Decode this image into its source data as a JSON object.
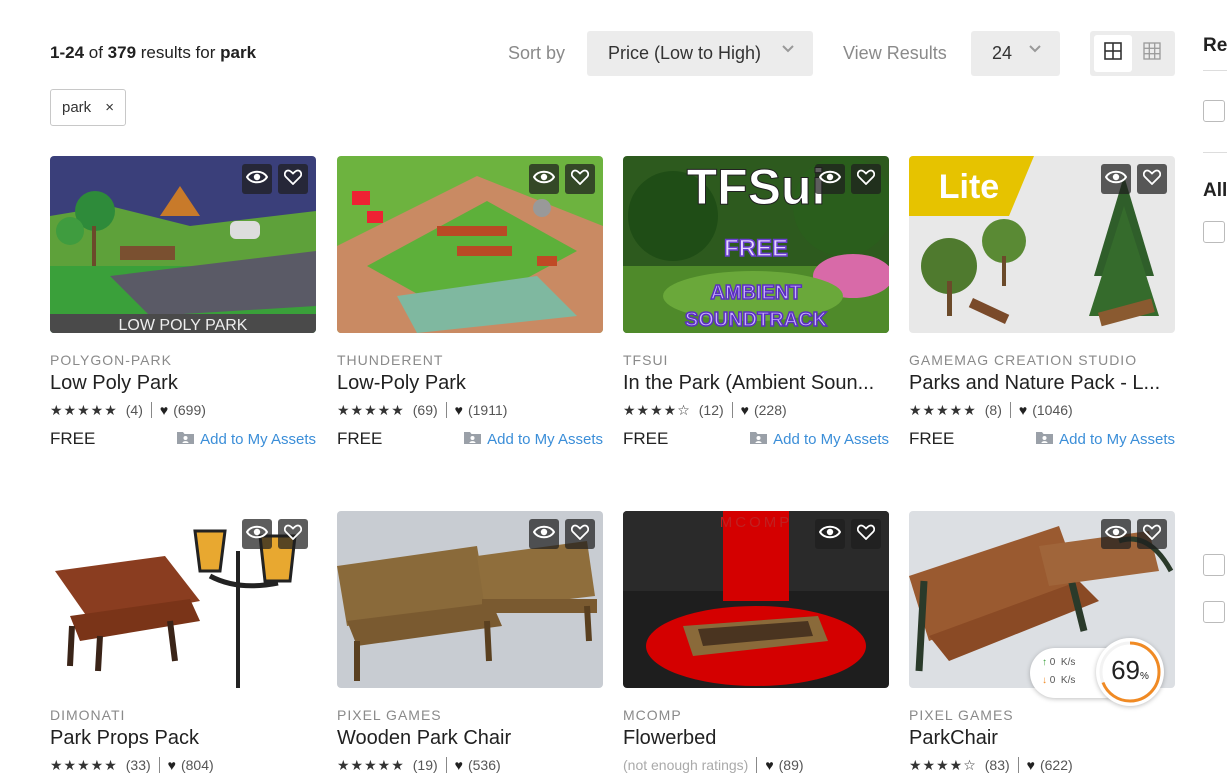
{
  "header": {
    "range": "1-24",
    "of_text": " of ",
    "total": "379",
    "results_for_text": " results for ",
    "query": "park",
    "sort_label": "Sort by",
    "sort_value": "Price (Low to High)",
    "view_label": "View Results",
    "view_value": "24"
  },
  "filter_chip": {
    "label": "park",
    "remove": "×"
  },
  "sidebar": {
    "heading_1": "Re",
    "heading_2": "All"
  },
  "add_label": "Add to My Assets",
  "cards": [
    {
      "publisher": "POLYGON-PARK",
      "title": "Low Poly Park",
      "stars": "★★★★★",
      "ratings": "(4)",
      "likes": "(699)",
      "price": "FREE",
      "overlay_text": "LOW POLY PARK"
    },
    {
      "publisher": "THUNDERENT",
      "title": "Low-Poly Park",
      "stars": "★★★★★",
      "ratings": "(69)",
      "likes": "(1911)",
      "price": "FREE"
    },
    {
      "publisher": "TFSUI",
      "title": "In the Park (Ambient Soun...",
      "stars": "★★★★☆",
      "ratings": "(12)",
      "likes": "(228)",
      "price": "FREE",
      "overlay_text": "TFSui",
      "overlay_free": "FREE",
      "overlay_ambient": "AMBIENT",
      "overlay_soundtrack": "SOUNDTRACK"
    },
    {
      "publisher": "GAMEMAG CREATION STUDIO",
      "title": "Parks and Nature Pack - L...",
      "stars": "★★★★★",
      "ratings": "(8)",
      "likes": "(1046)",
      "price": "FREE",
      "overlay_text": "Lite"
    },
    {
      "publisher": "DIMONATI",
      "title": "Park Props Pack",
      "stars": "★★★★★",
      "ratings": "(33)",
      "likes": "(804)"
    },
    {
      "publisher": "PIXEL GAMES",
      "title": "Wooden Park Chair",
      "stars": "★★★★★",
      "ratings": "(19)",
      "likes": "(536)"
    },
    {
      "publisher": "MCOMP",
      "title": "Flowerbed",
      "ratings": "(not enough ratings)",
      "likes": "(89)",
      "overlay_text": "MCOMP"
    },
    {
      "publisher": "PIXEL GAMES",
      "title": "ParkChair",
      "stars": "★★★★☆",
      "ratings": "(83)",
      "likes": "(622)"
    }
  ],
  "perf_widget": {
    "up": "0",
    "down": "0",
    "unit": "K/s",
    "percent": "69",
    "percent_sign": "%"
  },
  "colors": {
    "link": "#3b8ed8",
    "accent_orange": "#f08a24"
  },
  "icons": [
    "eye-icon",
    "heart-icon",
    "chevron-down-icon",
    "close-icon",
    "grid-large-icon",
    "grid-small-icon",
    "my-assets-icon"
  ]
}
